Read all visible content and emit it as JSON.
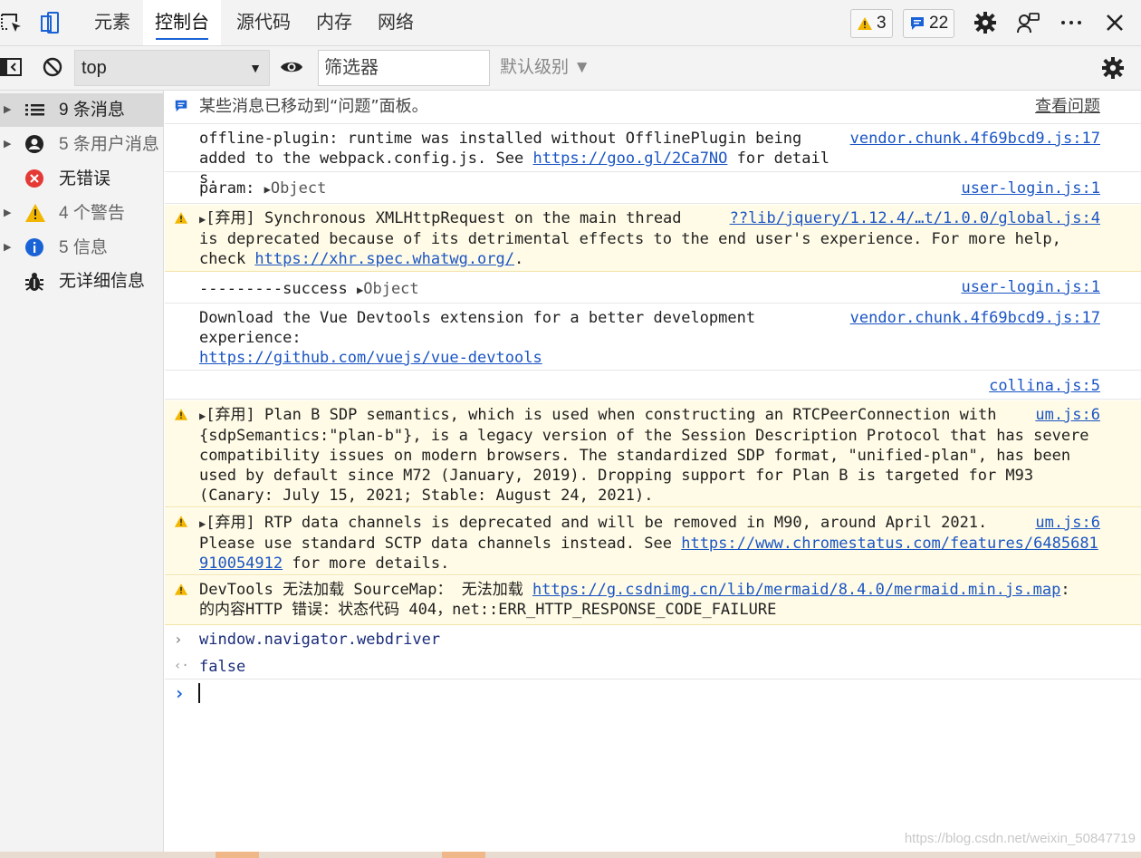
{
  "tabs": {
    "items": [
      {
        "label": "元素"
      },
      {
        "label": "控制台"
      },
      {
        "label": "源代码"
      },
      {
        "label": "内存"
      },
      {
        "label": "网络"
      }
    ],
    "active": "控制台",
    "warnings_count": "3",
    "messages_count": "22"
  },
  "toolbar": {
    "context": "top",
    "filter_placeholder": "筛选器",
    "levels_label": "默认级别 ▼"
  },
  "sidebar": {
    "items": [
      {
        "label": "9 条消息",
        "icon": "list-icon"
      },
      {
        "label": "5 条用户消息",
        "icon": "user-icon"
      },
      {
        "label": "无错误",
        "icon": "error-icon"
      },
      {
        "label": "4 个警告",
        "icon": "warning-icon"
      },
      {
        "label": "5 信息",
        "icon": "info-icon"
      },
      {
        "label": "无详细信息",
        "icon": "bug-icon"
      }
    ]
  },
  "console": {
    "issues_banner": {
      "text": "某些消息已移动到“问题”面板。",
      "link": "查看问题"
    },
    "msg1": {
      "text_a": "offline-plugin: runtime was installed without OfflinePlugin being\nadded to the webpack.config.js. See ",
      "link": "https://goo.gl/2Ca7NO",
      "text_b": " for details.",
      "source": "vendor.chunk.4f69bcd9.js:17"
    },
    "msg2": {
      "text": "param: ",
      "obj": "Object",
      "source": "user-login.js:1"
    },
    "msg3": {
      "tag": "[弃用]",
      "text_a": " Synchronous XMLHttpRequest on the main thread\nis deprecated because of its detrimental effects to the end user's experience. For more help,\ncheck ",
      "link": "https://xhr.spec.whatwg.org/",
      "text_b": ".",
      "source": "??lib/jquery/1.12.4/…t/1.0.0/global.js:4"
    },
    "msg4": {
      "text": "---------success ",
      "obj": "Object",
      "source": "user-login.js:1"
    },
    "msg5": {
      "text": "Download the Vue Devtools extension for a better development\nexperience:",
      "link": "https://github.com/vuejs/vue-devtools",
      "source": "vendor.chunk.4f69bcd9.js:17"
    },
    "msg6": {
      "source": "collina.js:5"
    },
    "msg7": {
      "tag": "[弃用]",
      "text": " Plan B SDP semantics, which is used when constructing an RTCPeerConnection with\n{sdpSemantics:\"plan-b\"}, is a legacy version of the Session Description Protocol that has severe\ncompatibility issues on modern browsers. The standardized SDP format, \"unified-plan\", has been\nused by default since M72 (January, 2019). Dropping support for Plan B is targeted for M93\n(Canary: July 15, 2021; Stable: August 24, 2021).",
      "source": "um.js:6"
    },
    "msg8": {
      "tag": "[弃用]",
      "text_a": " RTP data channels is deprecated and will be removed in M90, around April 2021.\nPlease use standard SCTP data channels instead. See ",
      "link": "https://www.chromestatus.com/features/6485681910054912",
      "text_b": " for more details.",
      "source": "um.js:6"
    },
    "msg9": {
      "text_a": "DevTools 无法加载 SourceMap： 无法加载 ",
      "link": "https://g.csdnimg.cn/lib/mermaid/8.4.0/mermaid.min.js.map",
      "text_b": ":\n的内容HTTP 错误：状态代码 404，net::ERR_HTTP_RESPONSE_CODE_FAILURE"
    },
    "input_expr": "window.navigator.webdriver",
    "result": "false"
  },
  "watermark": "https://blog.csdn.net/weixin_50847719",
  "colors": {
    "accent": "#1a63d6",
    "link": "#1a55c4",
    "warn_bg": "#fffbe6",
    "warn_icon": "#f2b600"
  }
}
